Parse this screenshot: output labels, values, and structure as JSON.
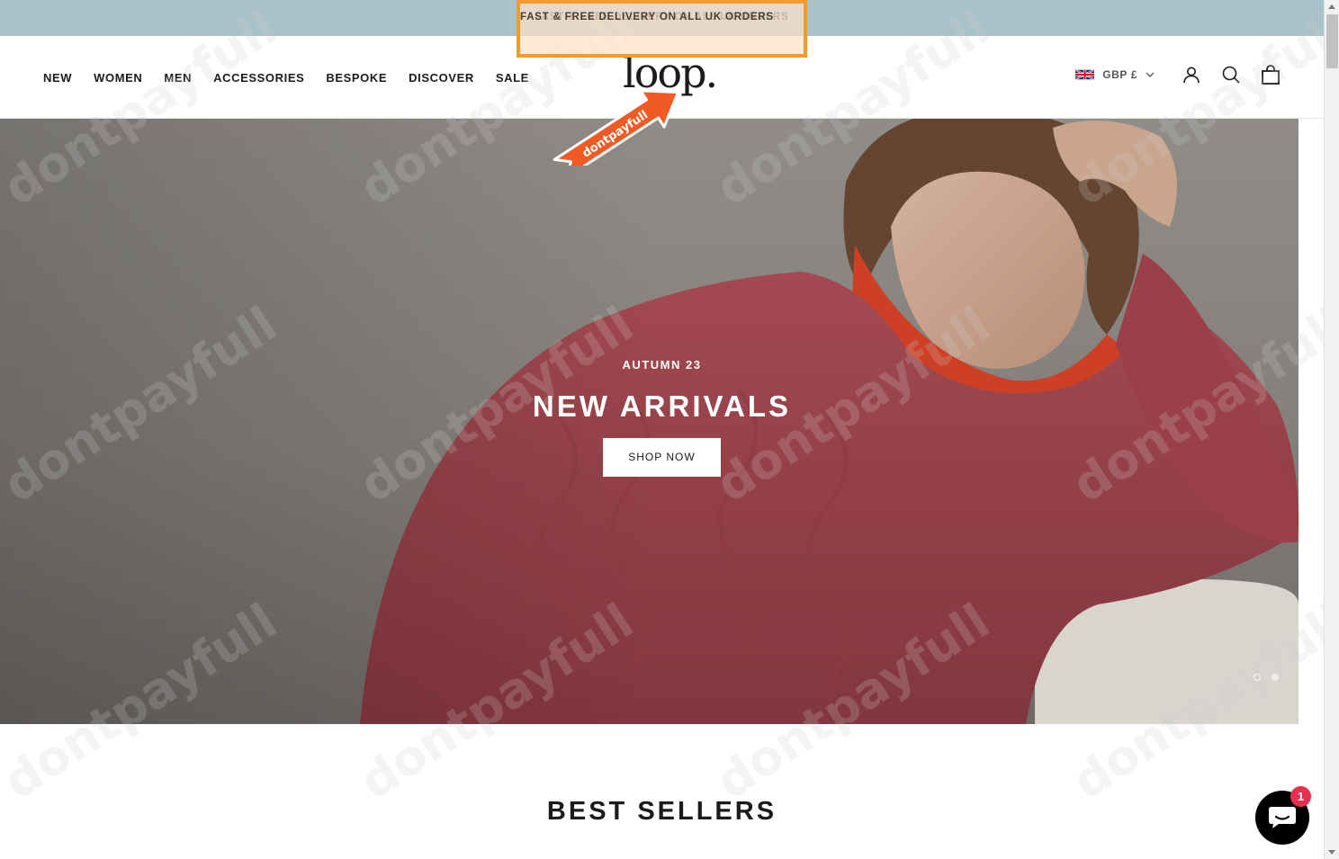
{
  "announcement": {
    "text": "FAST & FREE DELIVERY ON ALL UK ORDERS"
  },
  "nav": {
    "items": [
      "NEW",
      "WOMEN",
      "MEN",
      "ACCESSORIES",
      "BESPOKE",
      "DISCOVER",
      "SALE"
    ]
  },
  "logo": {
    "text": "loop."
  },
  "header": {
    "currency": "GBP £",
    "icons": [
      "uk-flag-icon",
      "chevron-down-icon",
      "account-icon",
      "search-icon",
      "cart-icon"
    ]
  },
  "hero": {
    "eyebrow": "AUTUMN 23",
    "title": "NEW ARRIVALS",
    "button": "SHOP NOW",
    "slide_count": 2,
    "active_slide": 1
  },
  "overlay": {
    "badge_text": "dontpayfull",
    "watermark_text": "dontpayfull"
  },
  "section": {
    "title": "BEST SELLERS"
  },
  "chat": {
    "badge_count": "1"
  },
  "colors": {
    "announcement_bg": "#a8c2c9",
    "highlight_border": "#f39a2f",
    "badge_orange": "#f15a24",
    "chat_badge": "#e5304f"
  }
}
